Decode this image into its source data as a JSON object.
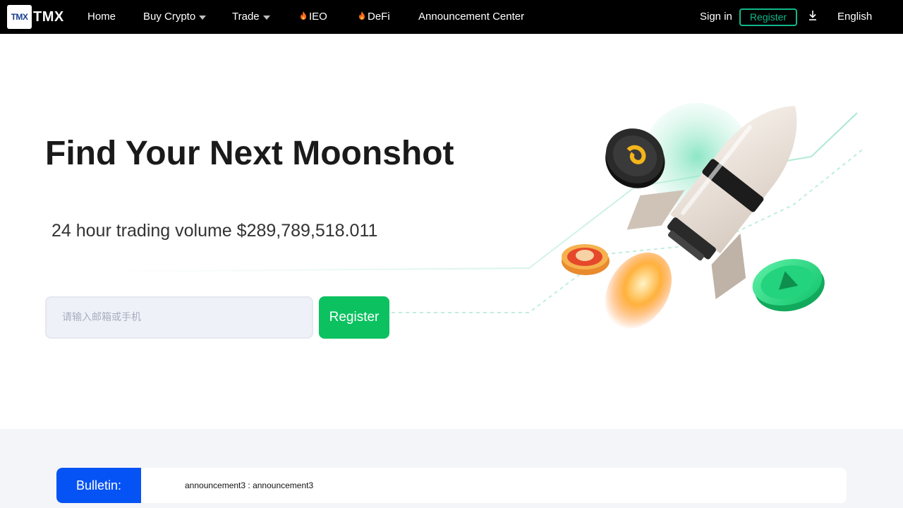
{
  "nav": {
    "logo_mark": "TMX",
    "logo_text": "TMX",
    "items": [
      {
        "label": "Home"
      },
      {
        "label": "Buy Crypto"
      },
      {
        "label": "Trade"
      },
      {
        "label": "IEO"
      },
      {
        "label": "DeFi"
      },
      {
        "label": "Announcement Center"
      }
    ],
    "sign_in": "Sign in",
    "register": "Register",
    "language": "English"
  },
  "hero": {
    "title": "Find Your Next Moonshot",
    "volume": "24 hour trading volume $289,789,518.011",
    "input_placeholder": "请输入邮箱或手机",
    "input_value": "",
    "register_button": "Register"
  },
  "bulletin": {
    "label": "Bulletin:",
    "text": "announcement3 : announcement3"
  },
  "colors": {
    "nav_bg": "#000000",
    "accent_green": "#0bc160",
    "nav_register_border": "#11b88a",
    "bulletin_blue": "#0653f5",
    "flame": "#ff6a1a"
  },
  "icons": {
    "dropdown": "chevron-down-icon",
    "hot": "flame-icon",
    "download": "download-icon"
  }
}
